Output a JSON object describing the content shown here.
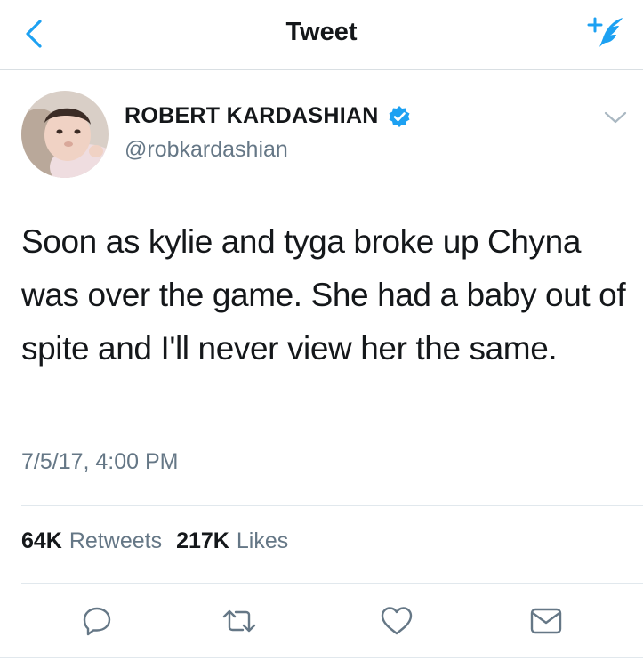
{
  "nav": {
    "title": "Tweet",
    "back_icon": "chevron-left-icon",
    "compose_icon": "compose-tweet-icon"
  },
  "tweet": {
    "display_name": "ROBERT KARDASHIAN",
    "handle": "@robkardashian",
    "verified": true,
    "text": "Soon as kylie and tyga broke up Chyna was over the game. She had a baby out of spite and I'll never view her the same.",
    "timestamp": "7/5/17, 4:00 PM",
    "retweets_count": "64K",
    "retweets_label": "Retweets",
    "likes_count": "217K",
    "likes_label": "Likes"
  },
  "actions": [
    {
      "icon": "reply-icon"
    },
    {
      "icon": "retweet-icon"
    },
    {
      "icon": "like-icon"
    },
    {
      "icon": "message-icon"
    }
  ],
  "colors": {
    "accent": "#1da1f2",
    "text_primary": "#14171a",
    "text_secondary": "#657786",
    "divider": "#e1e8ed"
  }
}
